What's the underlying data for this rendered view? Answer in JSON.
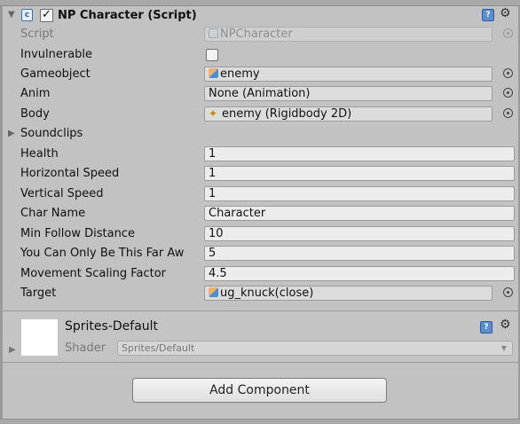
{
  "component": {
    "title": "NP Character (Script)",
    "enabled": true,
    "icons": [
      "script-icon",
      "help-icon",
      "gear-icon"
    ]
  },
  "properties": {
    "script": {
      "label": "Script",
      "value": "NPCharacter"
    },
    "invulnerable": {
      "label": "Invulnerable",
      "checked": false
    },
    "gameobject": {
      "label": "Gameobject",
      "value": "enemy"
    },
    "anim": {
      "label": "Anim",
      "value": "None (Animation)"
    },
    "body": {
      "label": "Body",
      "value": "enemy (Rigidbody 2D)"
    },
    "soundclips": {
      "label": "Soundclips"
    },
    "health": {
      "label": "Health",
      "value": "1"
    },
    "horizontal_speed": {
      "label": "Horizontal Speed",
      "value": "1"
    },
    "vertical_speed": {
      "label": "Vertical Speed",
      "value": "1"
    },
    "char_name": {
      "label": "Char Name",
      "value": "Character"
    },
    "min_follow_distance": {
      "label": "Min Follow Distance",
      "value": "10"
    },
    "far_away": {
      "label": "You Can Only Be This Far Aw",
      "value": "5"
    },
    "movement_scaling": {
      "label": "Movement Scaling Factor",
      "value": "4.5"
    },
    "target": {
      "label": "Target",
      "value": "ug_knuck(close)"
    }
  },
  "material": {
    "name": "Sprites-Default",
    "shader_label": "Shader",
    "shader_value": "Sprites/Default"
  },
  "add_component_label": "Add Component",
  "colors": {
    "panel_bg": "#c2c2c2",
    "field_bg": "#dcdcdc",
    "help_blue": "#5a8cd0"
  }
}
